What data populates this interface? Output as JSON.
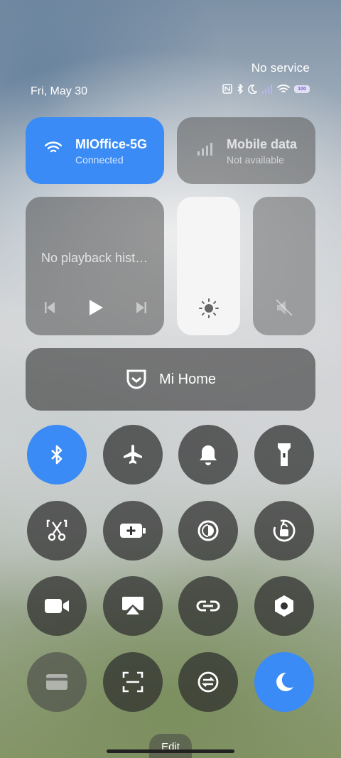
{
  "status": {
    "carrier": "No service",
    "date": "Fri, May 30",
    "battery": "100",
    "icons": [
      "nfc-icon",
      "bluetooth-icon",
      "moon-icon",
      "signal-icon",
      "wifi-icon",
      "battery-icon"
    ]
  },
  "wifi": {
    "name": "MIOffice-5G",
    "status": "Connected"
  },
  "mobile_data": {
    "title": "Mobile data",
    "status": "Not available"
  },
  "media": {
    "text": "No playback hist…"
  },
  "mi_home": {
    "label": "Mi Home"
  },
  "toggles": [
    {
      "name": "bluetooth",
      "on": true
    },
    {
      "name": "airplane-mode",
      "on": false
    },
    {
      "name": "sound",
      "on": false
    },
    {
      "name": "flashlight",
      "on": false
    },
    {
      "name": "screenshot",
      "on": false
    },
    {
      "name": "battery-saver",
      "on": false
    },
    {
      "name": "reading-mode",
      "on": false
    },
    {
      "name": "auto-rotate",
      "on": false
    },
    {
      "name": "screen-recorder",
      "on": false
    },
    {
      "name": "cast",
      "on": false
    },
    {
      "name": "link",
      "on": false
    },
    {
      "name": "settings",
      "on": false
    },
    {
      "name": "card",
      "on": false
    },
    {
      "name": "scanner",
      "on": false
    },
    {
      "name": "sync",
      "on": false
    },
    {
      "name": "dark-mode",
      "on": true
    }
  ],
  "edit_label": "Edit",
  "colors": {
    "accent": "#3a8bf5"
  }
}
